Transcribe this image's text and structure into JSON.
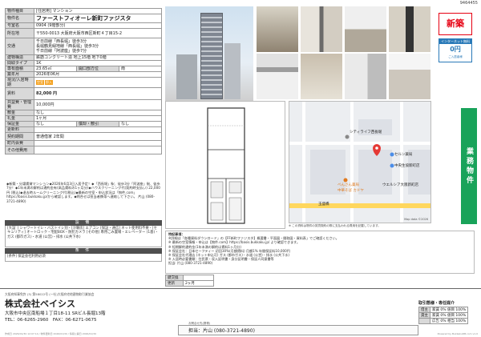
{
  "doc_id": "9464455",
  "property": {
    "type_label": "物件種目",
    "type_value": "[住居用] マンション",
    "name_label": "物件名",
    "name_value": "ファーストフィオーレ新町ファジスタ",
    "room_label": "号室名",
    "room_value": "0904 (9階部分)",
    "location_label": "所在地",
    "location_value": "〒550-0013 大阪府大阪市西区新町４丁目15-2",
    "traffic_label": "交通",
    "traffic_lines": [
      "千日前線「西長堀」徒歩3分",
      "長堀鶴見緑地線「西長堀」徒歩3分",
      "千日前線「阿波座」徒歩7分"
    ],
    "structure_label": "建物構造",
    "structure_value": "鉄筋コンクリート造 地上15階 地下0階",
    "layout_label": "間取タイプ",
    "layout_value": "1K",
    "area_label": "専有面積",
    "area_value": "23.65㎡",
    "window_label": "開口部方位",
    "window_value": "南",
    "built_label": "築年月",
    "built_value": "2026年06月",
    "status_label": "現況/入居時期",
    "status_badges": [
      "空室",
      "即入"
    ],
    "rent_label": "賃料",
    "rent_value": "82,000 円",
    "fee_label": "共益費・管理費",
    "fee_value": "10,000円",
    "deposit_label": "敷金",
    "deposit_value": "なし",
    "key_label": "礼金",
    "key_value": "1ヶ月",
    "guarantee_label": "保証金",
    "guarantee_value": "なし",
    "amortize_label": "償却・敷引",
    "amortize_value": "なし",
    "renew_label": "更新料",
    "renew_value": "",
    "contract_label": "契約期間",
    "contract_value": "普通借家 2年間",
    "town_label": "町内会費",
    "town_value": "",
    "other_label": "その他費用",
    "other_value": ""
  },
  "remarks": "◆新築・分譲賃貸マンション◆2026年6月3日入居予定！◆「西長堀」駅、徒歩3分「阿波座」駅、徒歩7分！◆1年未満の解約は違約金有(高品賃料の1ヶ月分)◆ハウスクリーニング代(契約時支払い) 22,000円 (税込)◆退去時ルームクリーニング代(税込)◆最新の空室・申込状況は「物件.com」https://basis.bukkaku.jp/から確認します。◆問合せは担当者携帯へ連絡して下さい。 片山 (080-3721-4890)",
  "equipment_head": "設 備",
  "equipment_text": "[大設ﾞ] シャワートイレ・バストイレ別・[冷暖房] エアコン [保証・通信] ネット使用料不要・[セキュリティ] オートロック・宅配BOX・防犯カメラ [その他] 専用ごみ置場・エレベーター (1基)・ガス (都市ガス)・水道 (公営)・排水 (公共下水)",
  "conditions_head": "条 件",
  "conditions_text": "[条件] 保証会社利用必須",
  "photo_labels": [
    "外観",
    "内装",
    "玄関",
    "室内",
    "洗面",
    "キッチン",
    "収納",
    "浴室",
    "トイレ"
  ],
  "badge_new": "新築",
  "internet_badge": {
    "top": "インターネット無料",
    "mid": "0円",
    "bottom": "ご入居者様"
  },
  "side_tag": "業務物件",
  "map": {
    "labels": [
      "シティライフ西長堀",
      "セルン薬局",
      "中央生協新町店",
      "べんさん薬局",
      "中華そば カドヤ",
      "ウエルシア大阪新町店",
      "玉盛橋"
    ],
    "copyright": "Map data ©2026",
    "note": "※ この資料は物件の賃貸契約の際に支払われる費用を記載しています。"
  },
  "notes": {
    "title": "特記事項：",
    "lines": [
      "※詳細は「各種資料ダウンロード」の【FF新町ファジスタ】概要書・平面図・間取図・資料表」でご確認ください。",
      "※ 最新の空室情報・申込は【物件.com】https://basis.bukkaku.jp/ より確認できます。",
      "※ 短期解約違約金(1年未満の解約は賃料1ヶ月分)",
      "※ 保証会社：日本セーフティー 初回30%(月額賃料) 月額1% 年間保証料10,000円",
      "※ 保証会社代理店 (ネット申込可) ガス (都市ガス)・水道 (公営)・排水 (公共下水)",
      "※ 入居時必要書類：住民票・収入証明書・身分証明書・保証人同意書等",
      "担当: 片山 (080-3721-4890)"
    ]
  },
  "sm_table": {
    "k1": "鍵交換",
    "v1": "",
    "k2": "更新",
    "v2": "2ヶ月"
  },
  "footer": {
    "license": "大阪府知事免許 (3) 第58022号 (一社)大阪府宅地建物取引業協会",
    "company": "株式会社ベイシス",
    "address": "大阪市中央区南船場１丁目18-11 SRビル長堀13階",
    "tel": "TEL：06-6265-2960　FAX：06-6271-0675",
    "contact_label": "お問合せ先(携帯)",
    "contact_value": "担当：片山 (080-3721-4890)",
    "fee_title": "取引態様・専任媒介",
    "fee_rows": [
      [
        "借主",
        "家賃 0% 値目 100%"
      ],
      [
        "貸主",
        "家賃 0% 値目 100%"
      ],
      [
        "",
        "広告 0% 相当 100%"
      ]
    ],
    "bottom_left": "作成日 2026/01/30 12:07:14 / 物件更新日 2026/01/30 / 情報公開日 2026/01/30",
    "bottom_right": "Powered by BukkakuDB.com v1.0"
  }
}
